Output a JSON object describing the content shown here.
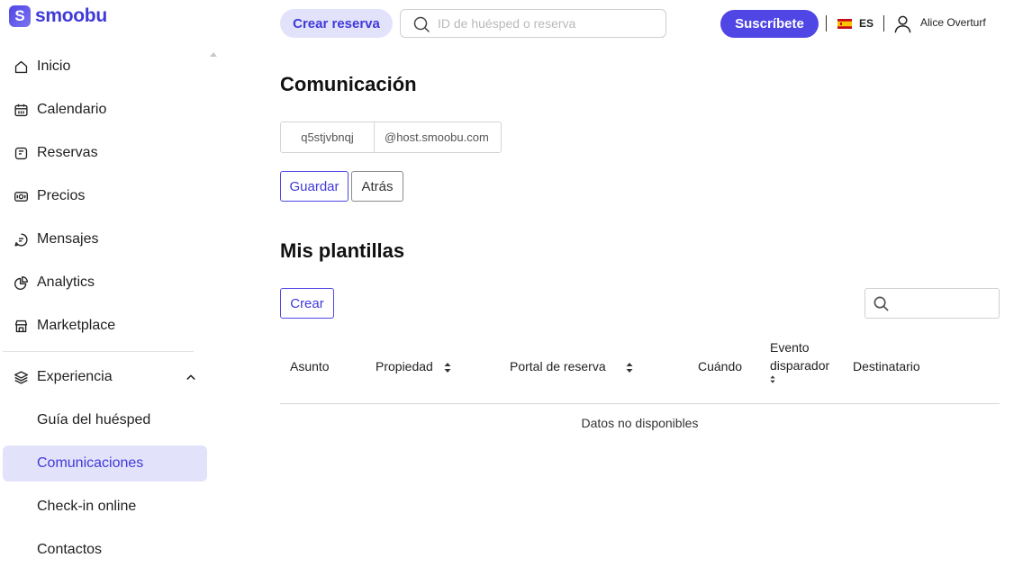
{
  "app": {
    "logo_letter": "S",
    "logo_text": "smoobu",
    "brand_color": "#4f46e5"
  },
  "sidebar": {
    "items": [
      {
        "label": "Inicio",
        "icon": "home-icon"
      },
      {
        "label": "Calendario",
        "icon": "calendar-icon"
      },
      {
        "label": "Reservas",
        "icon": "bookings-icon"
      },
      {
        "label": "Precios",
        "icon": "prices-icon"
      },
      {
        "label": "Mensajes",
        "icon": "messages-icon"
      },
      {
        "label": "Analytics",
        "icon": "analytics-icon"
      },
      {
        "label": "Marketplace",
        "icon": "marketplace-icon"
      }
    ],
    "section": {
      "label": "Experiencia",
      "icon": "layers-icon",
      "expanded": true
    },
    "subitems": [
      {
        "label": "Guía del huésped",
        "active": false
      },
      {
        "label": "Comunicaciones",
        "active": true
      },
      {
        "label": "Check-in online",
        "active": false
      },
      {
        "label": "Contactos",
        "active": false
      }
    ]
  },
  "topbar": {
    "create_booking_label": "Crear reserva",
    "search_placeholder": "ID de huésped o reserva",
    "subscribe_label": "Suscríbete",
    "language": "ES",
    "user_name": "Alice Overturf"
  },
  "main": {
    "title": "Comunicación",
    "email_local": "q5stjvbnqj",
    "email_domain": "@host.smoobu.com",
    "save_label": "Guardar",
    "back_label": "Atrás",
    "templates_title": "Mis plantillas",
    "create_label": "Crear",
    "templates_search_placeholder": "",
    "table": {
      "columns": [
        "Asunto",
        "Propiedad",
        "Portal de reserva",
        "Cuándo",
        "Evento disparador",
        "Destinatario"
      ],
      "empty_message": "Datos no disponibles"
    }
  }
}
